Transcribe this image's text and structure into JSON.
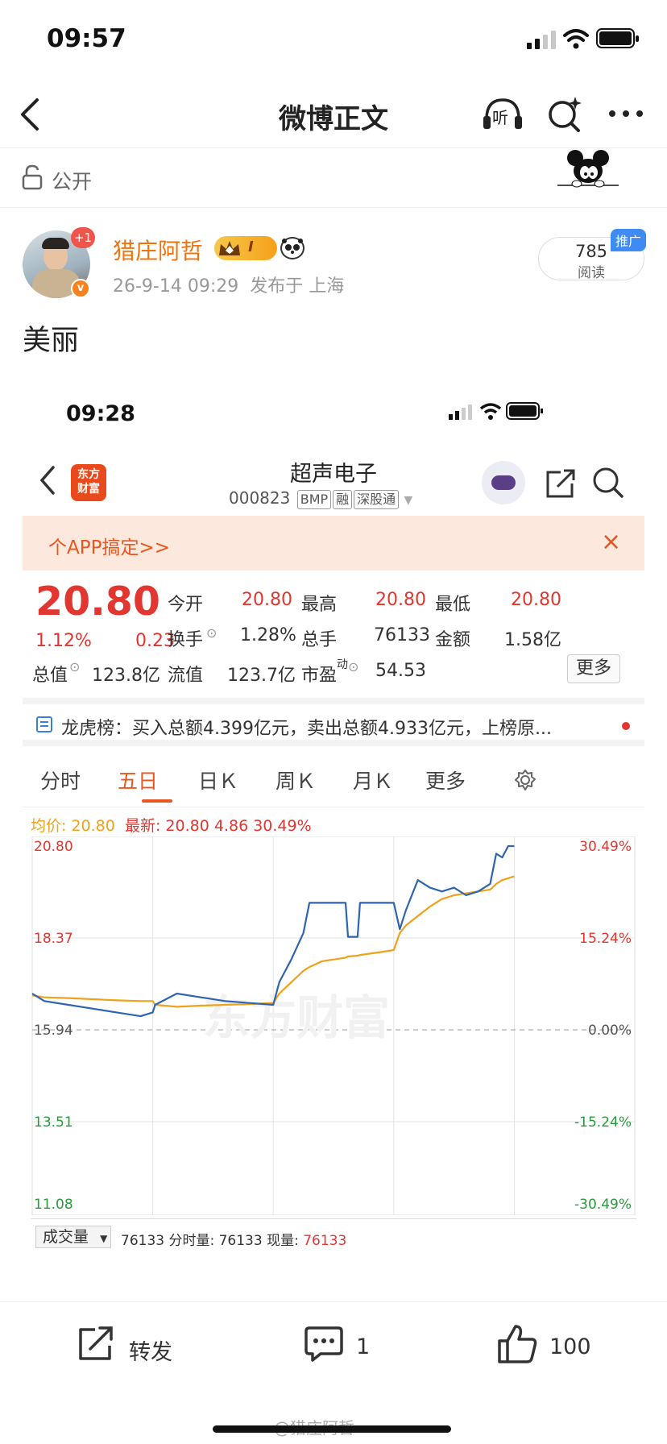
{
  "status_bar": {
    "time": "09:57"
  },
  "nav": {
    "title": "微博正文",
    "listen_label": "听"
  },
  "privacy": {
    "label": "公开"
  },
  "post": {
    "username": "猎庄阿哲",
    "vip_level": "I",
    "avatar_badge": "+1",
    "verified_mark": "v",
    "time": "26-9-14 09:29",
    "location": "发布于 上海",
    "reads_count": "785",
    "reads_label": "阅读",
    "promo_tag": "推广",
    "text": "美丽"
  },
  "screenshot": {
    "status_time": "09:28",
    "logo_line1": "东方",
    "logo_line2": "财富",
    "stock_name": "超声电子",
    "stock_code": "000823",
    "tags": [
      "BMP",
      "融",
      "深股通"
    ],
    "banner_text": "个APP搞定>>",
    "banner_close": "×",
    "price": "20.80",
    "change_pct": "1.12%",
    "change_amt": "0.23",
    "quotes": {
      "open_label": "今开",
      "open_value": "20.80",
      "high_label": "最高",
      "high_value": "20.80",
      "low_label": "最低",
      "low_value": "20.80",
      "turnover_label": "换手",
      "turnover_value": "1.28%",
      "volume_label": "总手",
      "volume_value": "76133",
      "amount_label": "金额",
      "amount_value": "1.58亿",
      "mktcap_label": "总值",
      "mktcap_value": "123.8亿",
      "float_label": "流值",
      "float_value": "123.7亿",
      "pe_label": "市盈",
      "pe_sup": "动",
      "pe_value": "54.53",
      "more_label": "更多"
    },
    "lhb_text": "龙虎榜：买入总额4.399亿元，卖出总额4.933亿元，上榜原...",
    "tabs": [
      "分时",
      "五日",
      "日Ｋ",
      "周Ｋ",
      "月Ｋ",
      "更多"
    ],
    "active_tab": "五日",
    "legend": {
      "avg_label": "均价:",
      "avg_value": "20.80",
      "latest_label": "最新:",
      "latest_value": "20.80",
      "latest_change": "4.86",
      "latest_pct": "30.49%"
    },
    "watermark": "东方财富",
    "volume_select": "成交量",
    "volume_line_prefix": "76133 分时量: 76133 现量: ",
    "volume_current": "76133"
  },
  "chart_data": {
    "type": "line",
    "title": "",
    "y_ticks_left": [
      "20.80",
      "18.37",
      "15.94",
      "13.51",
      "11.08"
    ],
    "y_ticks_right": [
      "30.49%",
      "15.24%",
      "0.00%",
      "-15.24%",
      "-30.49%"
    ],
    "ylim": [
      11.08,
      20.8
    ],
    "prev_close": 15.94,
    "days": 5,
    "x": [
      0,
      0.1,
      0.3,
      0.5,
      0.7,
      0.9,
      1.0,
      1.02,
      1.2,
      1.4,
      1.6,
      1.8,
      2.0,
      2.05,
      2.15,
      2.25,
      2.3,
      2.4,
      2.6,
      2.62,
      2.7,
      2.72,
      2.9,
      3.0,
      3.05,
      3.1,
      3.2,
      3.3,
      3.4,
      3.5,
      3.6,
      3.7,
      3.8,
      3.85,
      3.9,
      3.95,
      4.0
    ],
    "series": [
      {
        "name": "最新",
        "color": "#2f64b0",
        "values": [
          16.9,
          16.7,
          16.6,
          16.5,
          16.4,
          16.3,
          16.4,
          16.6,
          16.9,
          16.8,
          16.7,
          16.65,
          16.6,
          17.2,
          17.8,
          18.5,
          19.3,
          19.3,
          19.3,
          18.4,
          18.4,
          19.3,
          19.3,
          19.3,
          18.6,
          19.1,
          19.9,
          19.7,
          19.6,
          19.7,
          19.5,
          19.6,
          19.8,
          20.6,
          20.5,
          20.8,
          20.8
        ]
      },
      {
        "name": "均价",
        "color": "#f0a21a",
        "values": [
          16.85,
          16.8,
          16.78,
          16.75,
          16.72,
          16.7,
          16.7,
          16.6,
          16.55,
          16.58,
          16.6,
          16.62,
          16.65,
          16.9,
          17.2,
          17.5,
          17.6,
          17.75,
          17.85,
          17.88,
          17.9,
          17.92,
          18.0,
          18.05,
          18.5,
          18.7,
          18.95,
          19.2,
          19.4,
          19.5,
          19.55,
          19.6,
          19.65,
          19.8,
          19.9,
          19.95,
          20.0
        ]
      }
    ]
  },
  "bottom_bar": {
    "repost_label": "转发",
    "comment_count": "1",
    "like_count": "100"
  },
  "footer_watermark": "@猎庄阿哲"
}
